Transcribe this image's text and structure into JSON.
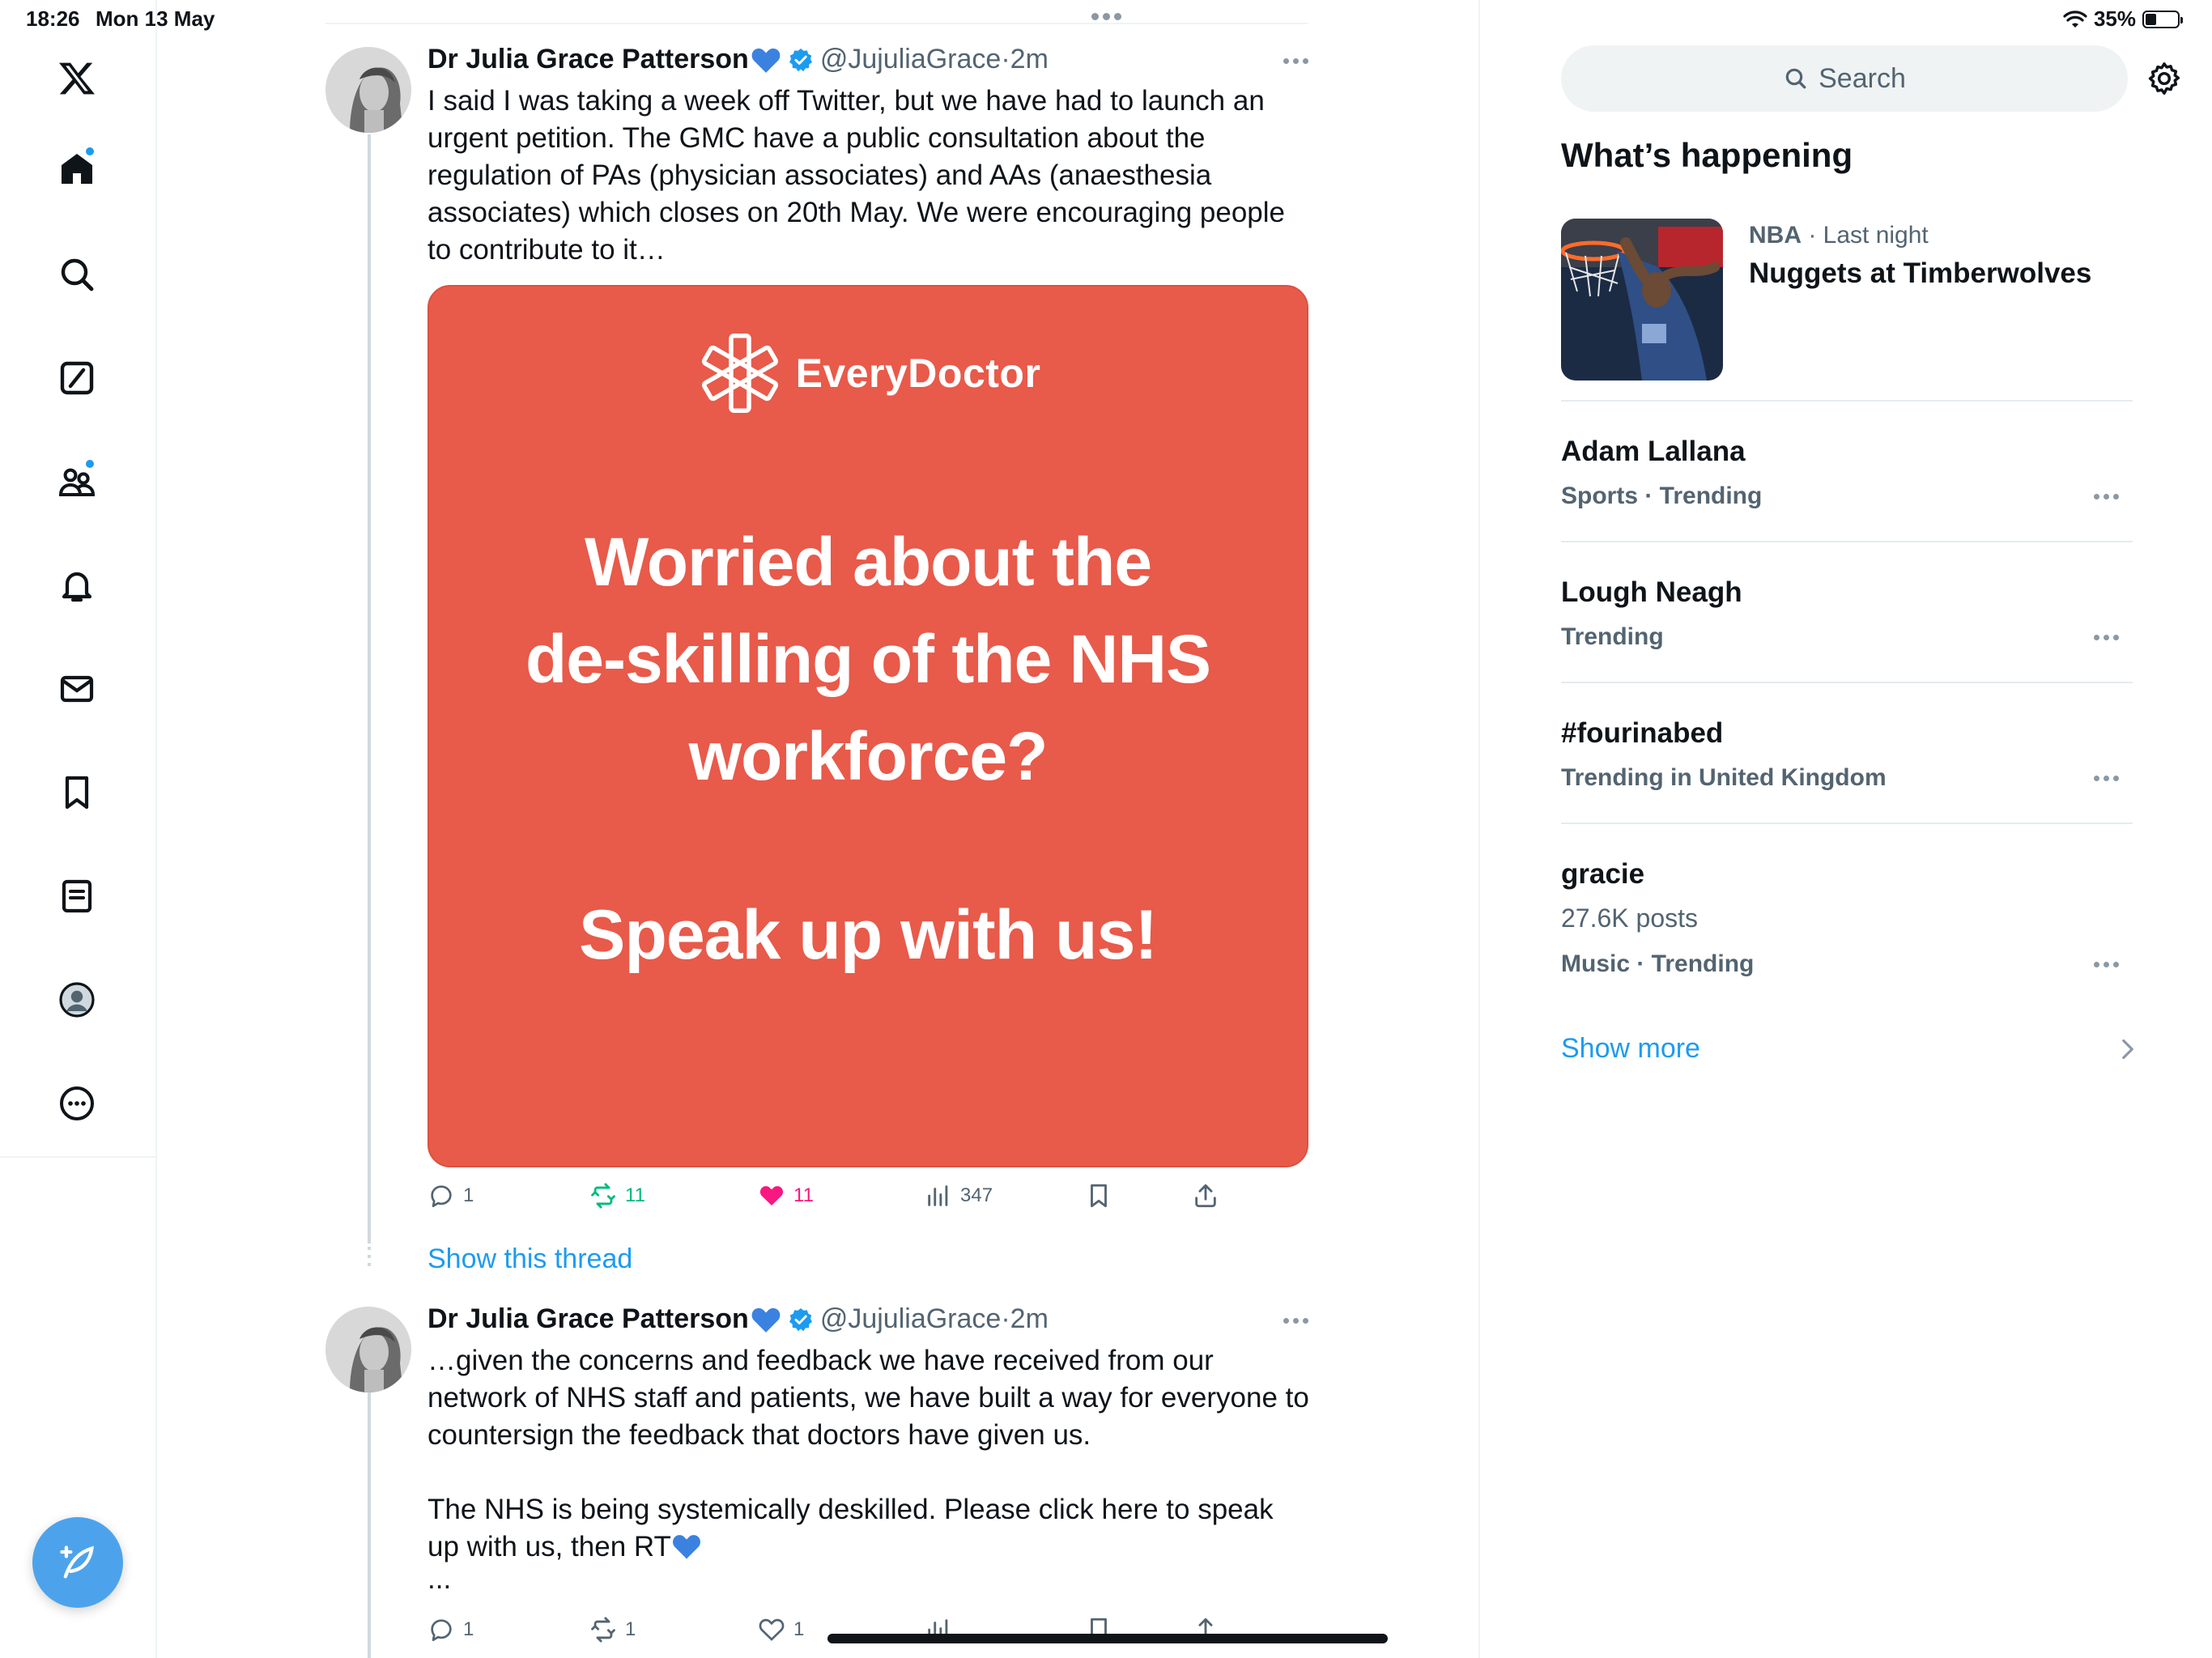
{
  "status_bar": {
    "time": "18:26",
    "date": "Mon 13 May",
    "battery": "35%",
    "battery_level": 0.35
  },
  "nav": {
    "items": [
      "x-logo-icon",
      "home-icon",
      "explore-icon",
      "grok-icon",
      "communities-icon",
      "notifications-icon",
      "messages-icon",
      "bookmarks-icon",
      "lists-icon",
      "profile-icon",
      "more-icon"
    ],
    "compose_icon": "compose-icon"
  },
  "tweets": [
    {
      "author": "Dr Julia Grace Patterson",
      "handle": "@JujuliaGrace",
      "time": "2m",
      "text": [
        "I said I was taking a week off Twitter, but we have had to launch an urgent petition. The GMC have a public consultation about the regulation of PAs (physician associates) and AAs (anaesthesia associates) which closes on 20th May. We were encouraging people to contribute to it…"
      ],
      "media": {
        "logo": "EveryDoctor",
        "headline": [
          "Worried about the",
          "de-skilling of the NHS",
          "workforce?"
        ],
        "cta": "Speak up with us!"
      },
      "actions": {
        "replies": "1",
        "retweets": "11",
        "likes": "11",
        "views": "347"
      },
      "show_thread": "Show this thread"
    },
    {
      "author": "Dr Julia Grace Patterson",
      "handle": "@JujuliaGrace",
      "time": "2m",
      "text": [
        "…given the concerns and feedback we have received from our network of NHS staff and patients, we have built a way for everyone to countersign the feedback that doctors have given us.",
        "The NHS is being systemically deskilled. Please click here to speak up with us, then RT",
        "..."
      ],
      "actions": {
        "replies": "1",
        "retweets": "1",
        "likes": "1"
      }
    }
  ],
  "sidebar": {
    "search_placeholder": "Search",
    "section_title": "What’s happening",
    "featured": {
      "category": "NBA",
      "time": "Last night",
      "title": "Nuggets at Timberwolves"
    },
    "trends": [
      {
        "title": "Adam Lallana",
        "meta": "Sports · Trending"
      },
      {
        "title": "Lough Neagh",
        "meta": "Trending"
      },
      {
        "title": "#fourinabed",
        "meta": "Trending in United Kingdom"
      },
      {
        "title": "gracie",
        "count": "27.6K posts",
        "meta": "Music · Trending"
      }
    ],
    "show_more": "Show more"
  },
  "colors": {
    "accent": "#1d9bf0",
    "like": "#f91880",
    "retweet": "#00ba7c",
    "card_bg": "#e85a4a",
    "fab": "#4da3eb"
  }
}
